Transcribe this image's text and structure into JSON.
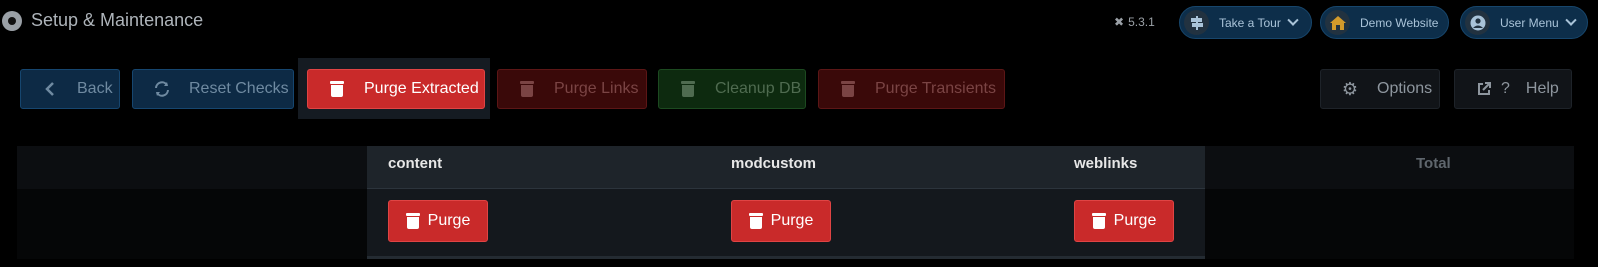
{
  "header": {
    "title": "Setup & Maintenance",
    "version": "5.3.1",
    "tour_label": "Take a Tour",
    "demo_label": "Demo Website",
    "user_label": "User Menu"
  },
  "toolbar": {
    "back": "Back",
    "reset_checks": "Reset Checks",
    "purge_extracted": "Purge Extracted",
    "purge_links": "Purge Links",
    "cleanup_db": "Cleanup DB",
    "purge_transients": "Purge Transients",
    "options": "Options",
    "help": "Help",
    "help_question": "?"
  },
  "table": {
    "columns": [
      "content",
      "modcustom",
      "weblinks",
      "Total"
    ],
    "purge_label": "Purge"
  },
  "icons": {
    "app": "app-icon",
    "version": "joomla-icon",
    "tour": "signpost-icon",
    "demo": "home-icon",
    "user": "user-circle-icon",
    "back": "chevron-left-icon",
    "reset": "sync-icon",
    "trash": "trash-icon",
    "options": "gear-icon",
    "help": "external-link-icon"
  },
  "colors": {
    "danger": "#c92a2a",
    "primary_dark": "#0d2a45",
    "success_dark": "#0d2a0f"
  }
}
